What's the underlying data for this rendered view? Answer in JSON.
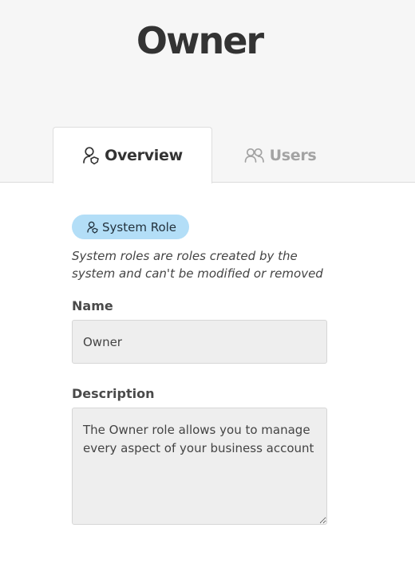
{
  "header": {
    "title": "Owner"
  },
  "tabs": [
    {
      "label": "Overview",
      "icon": "user-shield-icon",
      "active": true
    },
    {
      "label": "Users",
      "icon": "users-icon",
      "active": false
    }
  ],
  "badge": {
    "label": "System Role",
    "icon": "user-shield-icon",
    "color": "#b3def7"
  },
  "note": "System roles are roles created by the system and can't be modified or removed",
  "form": {
    "name_label": "Name",
    "name_value": "Owner",
    "description_label": "Description",
    "description_value": "The Owner role allows you to manage every aspect of your business account"
  },
  "colors": {
    "header_bg": "#f6f6f6",
    "inactive_tab_text": "#a3a3a3"
  }
}
